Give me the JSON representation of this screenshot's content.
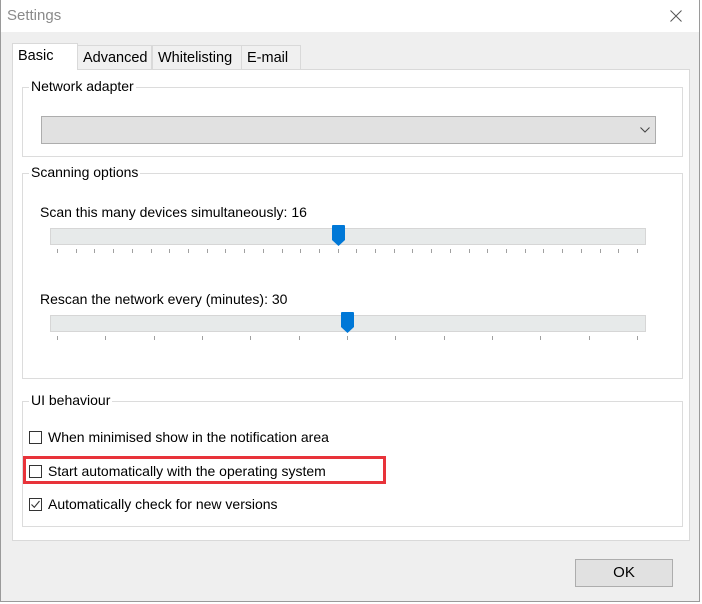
{
  "window": {
    "title": "Settings",
    "close_icon": "close-icon"
  },
  "tabs": [
    {
      "label": "Basic",
      "active": true
    },
    {
      "label": "Advanced",
      "active": false
    },
    {
      "label": "Whitelisting",
      "active": false
    },
    {
      "label": "E-mail",
      "active": false
    }
  ],
  "network_adapter": {
    "group_label": "Network adapter",
    "combo_value": "",
    "dropdown_icon": "chevron-down-icon"
  },
  "scanning_options": {
    "group_label": "Scanning options",
    "simultaneous": {
      "label": "Scan this many devices simultaneously: 16",
      "value": 16,
      "tick_count": 32,
      "thumb_tick_index": 15
    },
    "rescan": {
      "label": "Rescan the network every (minutes): 30",
      "value": 30,
      "tick_count": 13,
      "thumb_tick_index": 6
    }
  },
  "ui_behaviour": {
    "group_label": "UI behaviour",
    "options": [
      {
        "label": "When minimised show in the notification area",
        "checked": false,
        "highlighted": false
      },
      {
        "label": "Start automatically with the operating system",
        "checked": false,
        "highlighted": true
      },
      {
        "label": "Automatically check for new versions",
        "checked": true,
        "highlighted": false
      }
    ]
  },
  "buttons": {
    "ok": "OK"
  },
  "colors": {
    "accent": "#0078d7",
    "highlight": "#e8333a"
  }
}
